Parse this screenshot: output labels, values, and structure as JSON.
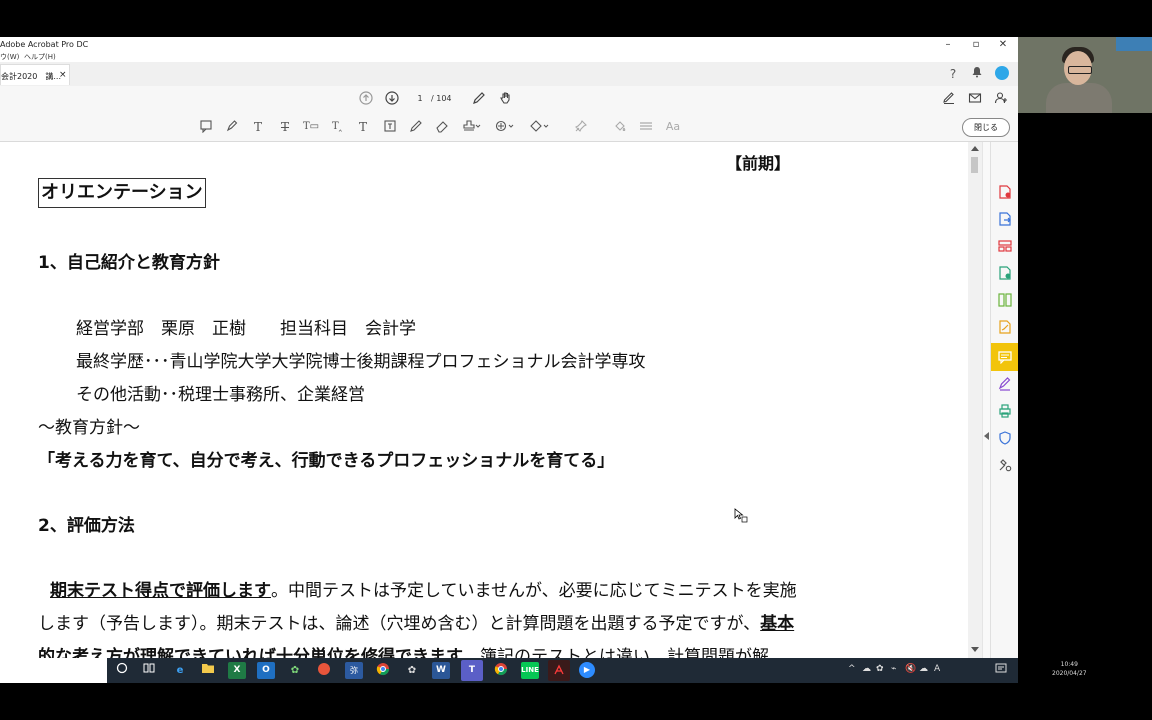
{
  "window": {
    "title": "Adobe Acrobat Pro DC",
    "menu": [
      "ウ(W)",
      "ヘルプ(H)"
    ],
    "controls": [
      "–",
      "▫",
      "✕"
    ]
  },
  "tab": {
    "label": "会計2020　講...",
    "close": "×"
  },
  "nav": {
    "page_current": "1",
    "page_total": "/ 104"
  },
  "toolbar": {
    "close_label": "閉じる",
    "text_style_label": "Aa"
  },
  "document": {
    "term": "【前期】",
    "orientation": "オリエンテーション",
    "section1": "1、自己紹介と教育方針",
    "profile1": "経営学部　栗原　正樹　　担当科目　会計学",
    "profile2": "最終学歴･･･青山学院大学大学院博士後期課程プロフェショナル会計学専攻",
    "profile3": "その他活動･･税理士事務所、企業経営",
    "policy_heading": "～教育方針～",
    "policy": "「考える力を育て、自分で考え、行動できるプロフェッショナルを育てる」",
    "section2": "2、評価方法",
    "eval1_bold": "期末テスト得点で評価します",
    "eval1_rest": "。中間テストは予定していませんが、必要に応じてミニテストを実施",
    "eval2_start": "します（予告します）。期末テストは、論述（穴埋め含む）と計算問題を出題する予定ですが、",
    "eval2_bold": "基本",
    "eval3_bold": "的な考え方が理解できていれば十分単位を修得できます",
    "eval3_rest": "。簿記のテストとは違い、計算問題が解"
  },
  "taskbar": {
    "apps": [
      "search-circle",
      "task-view",
      "edge",
      "explorer",
      "excel",
      "outlook",
      "paw-app",
      "fire-app",
      "tool-app",
      "chrome",
      "paw-app-2",
      "word",
      "teams",
      "chrome-2",
      "line",
      "acrobat",
      "zoom"
    ],
    "tray_input": "A",
    "time": "10:49",
    "date": "2020/04/27"
  }
}
